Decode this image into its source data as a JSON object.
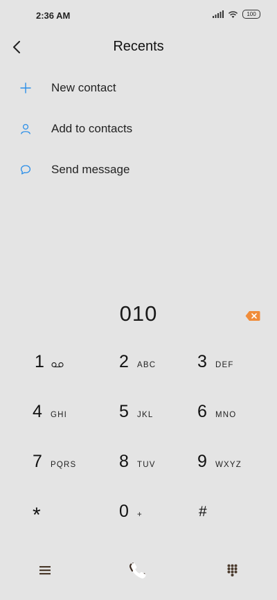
{
  "status": {
    "time": "2:36 AM",
    "battery": "100"
  },
  "header": {
    "title": "Recents"
  },
  "actions": [
    {
      "label": "New contact",
      "icon": "plus-icon"
    },
    {
      "label": "Add to contacts",
      "icon": "person-icon"
    },
    {
      "label": "Send message",
      "icon": "message-bubble-icon"
    }
  ],
  "dialer": {
    "number": "010"
  },
  "keypad": [
    {
      "digit": "1",
      "letters": ""
    },
    {
      "digit": "2",
      "letters": "ABC"
    },
    {
      "digit": "3",
      "letters": "DEF"
    },
    {
      "digit": "4",
      "letters": "GHI"
    },
    {
      "digit": "5",
      "letters": "JKL"
    },
    {
      "digit": "6",
      "letters": "MNO"
    },
    {
      "digit": "7",
      "letters": "PQRS"
    },
    {
      "digit": "8",
      "letters": "TUV"
    },
    {
      "digit": "9",
      "letters": "WXYZ"
    },
    {
      "digit": "*",
      "letters": ""
    },
    {
      "digit": "0",
      "letters": "+"
    },
    {
      "digit": "#",
      "letters": ""
    }
  ],
  "colors": {
    "accent": "#2a8ee8",
    "backspace": "#f08c3a",
    "background": "#e4e4e4"
  }
}
